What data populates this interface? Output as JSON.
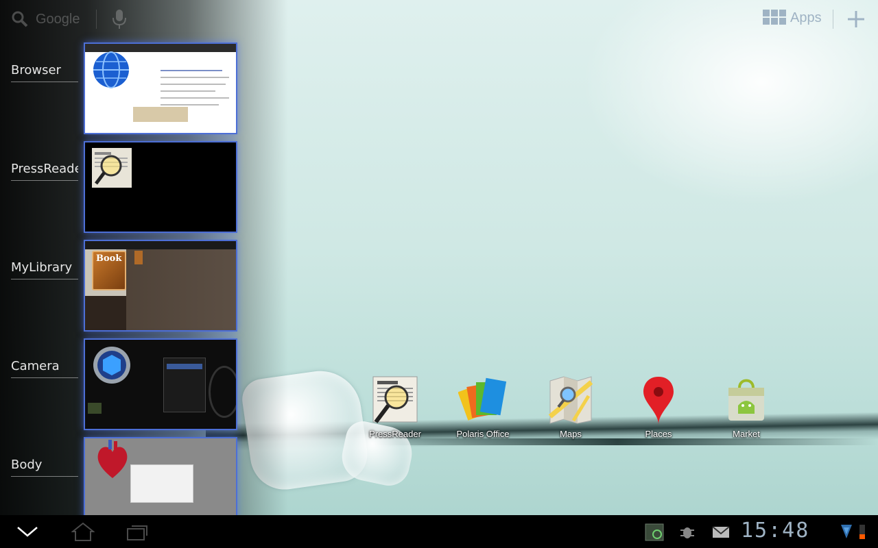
{
  "search": {
    "placeholder": "Google"
  },
  "header": {
    "apps_label": "Apps"
  },
  "recents": [
    {
      "label": "Browser"
    },
    {
      "label": "PressReade"
    },
    {
      "label": "MyLibrary"
    },
    {
      "label": "Camera"
    },
    {
      "label": "Body"
    }
  ],
  "shortcuts": [
    {
      "label": "PressReader"
    },
    {
      "label": "Polaris Office"
    },
    {
      "label": "Maps"
    },
    {
      "label": "Places"
    },
    {
      "label": "Market"
    }
  ],
  "thumb_text": {
    "book_title": "Book"
  },
  "status": {
    "time": "15:48"
  },
  "colors": {
    "accent": "#4d6fd6",
    "clock": "#9fb3c4",
    "battery": "#ff5a00"
  }
}
